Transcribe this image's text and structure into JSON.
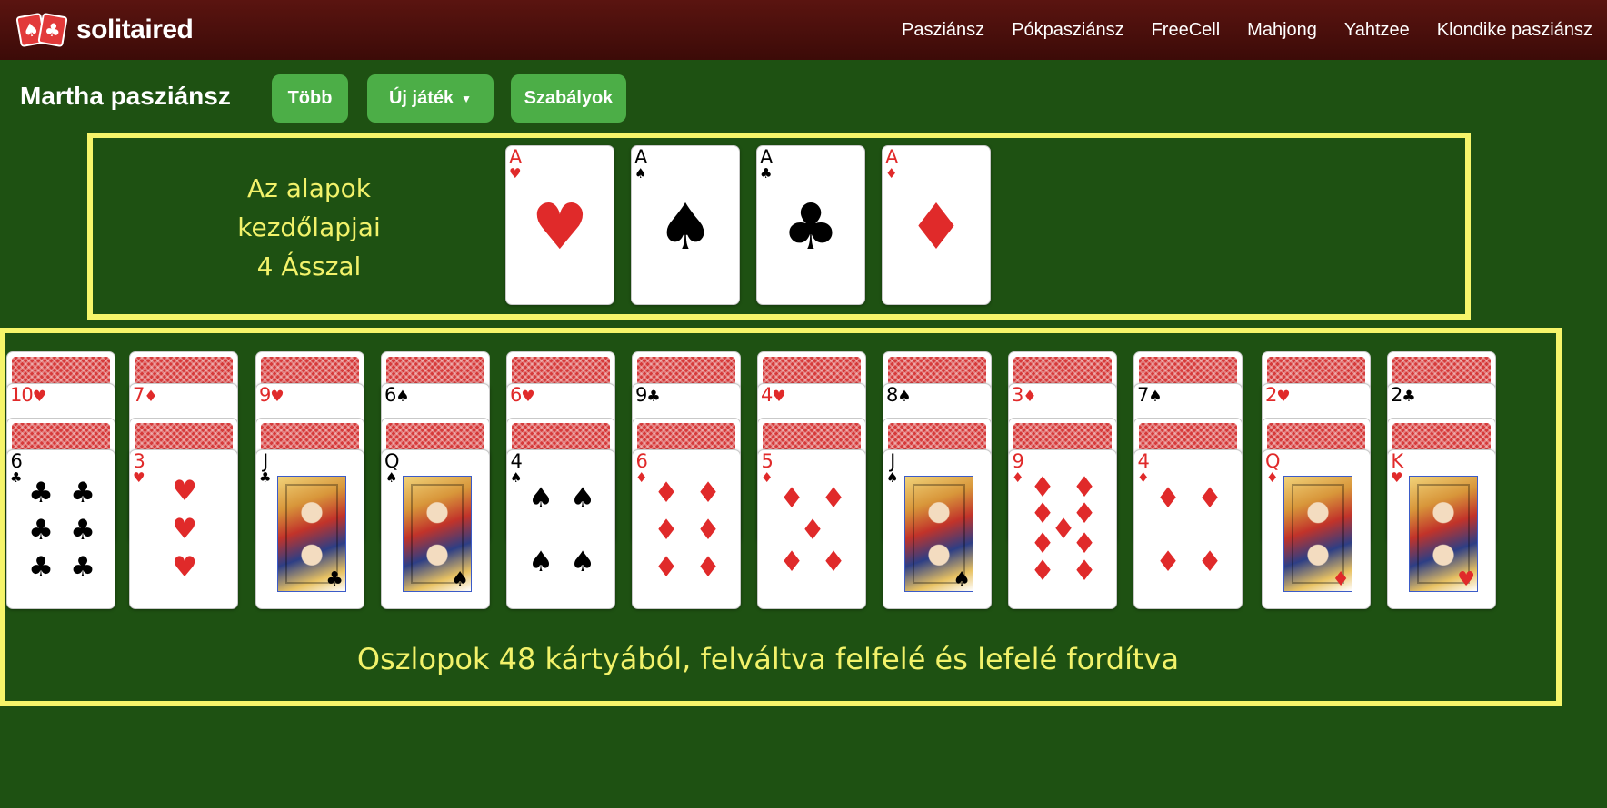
{
  "header": {
    "logo_text": "solitaired",
    "nav": [
      "Pasziánsz",
      "Pókpasziánsz",
      "FreeCell",
      "Mahjong",
      "Yahtzee",
      "Klondike pasziánsz"
    ]
  },
  "toolbar": {
    "title": "Martha pasziánsz",
    "more_label": "Több",
    "new_game_label": "Új játék",
    "rules_label": "Szabályok"
  },
  "captions": {
    "foundations_line1": "Az alapok",
    "foundations_line2": "kezdőlapjai",
    "foundations_line3": "4 Ásszal",
    "columns": "Oszlopok 48 kártyából, felváltva felfelé és lefelé fordítva"
  },
  "colors": {
    "table": "#1e5112",
    "header": "#4a100c",
    "button": "#4cae47",
    "highlight": "#f6f56a",
    "red_suit": "#e02a2a",
    "card_back": "#d63a3a"
  },
  "foundations": [
    {
      "rank": "A",
      "suit": "♥",
      "color": "red"
    },
    {
      "rank": "A",
      "suit": "♠",
      "color": "black"
    },
    {
      "rank": "A",
      "suit": "♣",
      "color": "black"
    },
    {
      "rank": "A",
      "suit": "♦",
      "color": "red"
    }
  ],
  "tableau": [
    {
      "up": {
        "rank": "10",
        "suit": "♥",
        "color": "red"
      },
      "bottom": {
        "rank": "6",
        "suit": "♣",
        "color": "black"
      }
    },
    {
      "up": {
        "rank": "7",
        "suit": "♦",
        "color": "red"
      },
      "bottom": {
        "rank": "3",
        "suit": "♥",
        "color": "red"
      }
    },
    {
      "up": {
        "rank": "9",
        "suit": "♥",
        "color": "red"
      },
      "bottom": {
        "rank": "J",
        "suit": "♣",
        "color": "black"
      }
    },
    {
      "up": {
        "rank": "6",
        "suit": "♠",
        "color": "black"
      },
      "bottom": {
        "rank": "Q",
        "suit": "♠",
        "color": "black"
      }
    },
    {
      "up": {
        "rank": "6",
        "suit": "♥",
        "color": "red"
      },
      "bottom": {
        "rank": "4",
        "suit": "♠",
        "color": "black"
      }
    },
    {
      "up": {
        "rank": "9",
        "suit": "♣",
        "color": "black"
      },
      "bottom": {
        "rank": "6",
        "suit": "♦",
        "color": "red"
      }
    },
    {
      "up": {
        "rank": "4",
        "suit": "♥",
        "color": "red"
      },
      "bottom": {
        "rank": "5",
        "suit": "♦",
        "color": "red"
      }
    },
    {
      "up": {
        "rank": "8",
        "suit": "♠",
        "color": "black"
      },
      "bottom": {
        "rank": "J",
        "suit": "♠",
        "color": "black"
      }
    },
    {
      "up": {
        "rank": "3",
        "suit": "♦",
        "color": "red"
      },
      "bottom": {
        "rank": "9",
        "suit": "♦",
        "color": "red"
      }
    },
    {
      "up": {
        "rank": "7",
        "suit": "♠",
        "color": "black"
      },
      "bottom": {
        "rank": "4",
        "suit": "♦",
        "color": "red"
      }
    },
    {
      "up": {
        "rank": "2",
        "suit": "♥",
        "color": "red"
      },
      "bottom": {
        "rank": "Q",
        "suit": "♦",
        "color": "red"
      }
    },
    {
      "up": {
        "rank": "2",
        "suit": "♣",
        "color": "black"
      },
      "bottom": {
        "rank": "K",
        "suit": "♥",
        "color": "red"
      }
    }
  ]
}
